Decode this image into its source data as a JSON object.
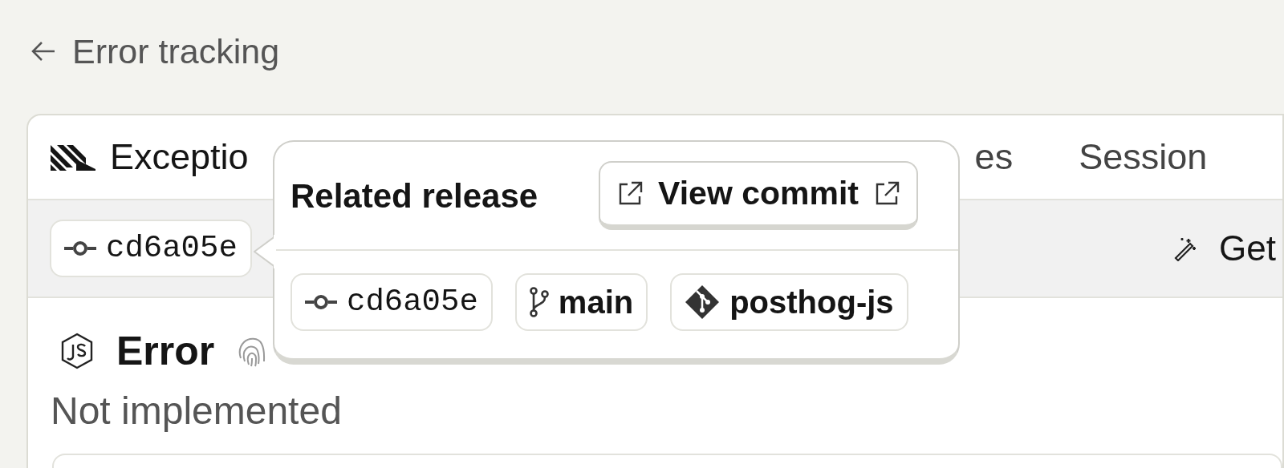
{
  "back_link": {
    "label": "Error tracking"
  },
  "tabs": [
    {
      "label": "Exceptio",
      "kind": "exception"
    },
    {
      "label": "es",
      "kind": "plain"
    },
    {
      "label": "Session",
      "kind": "plain"
    }
  ],
  "toolbar": {
    "commit_chip": "cd6a05e",
    "action": "Get"
  },
  "error": {
    "type": "Error",
    "message": "Not implemented"
  },
  "popover": {
    "title": "Related release",
    "button": "View commit",
    "chips": [
      {
        "kind": "commit",
        "label": "cd6a05e"
      },
      {
        "kind": "branch",
        "label": "main"
      },
      {
        "kind": "repo",
        "label": "posthog-js"
      }
    ]
  }
}
